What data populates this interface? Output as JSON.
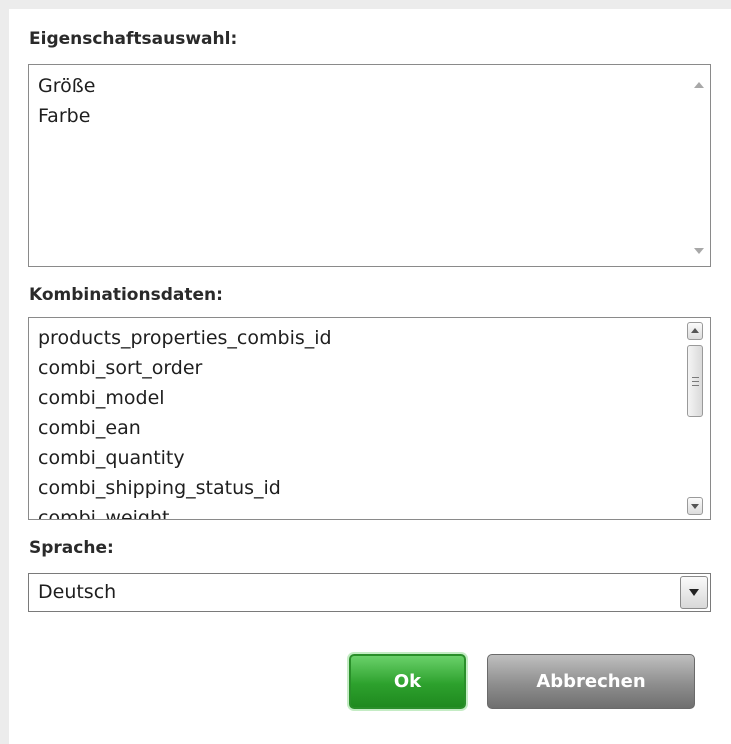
{
  "property_selection": {
    "label": "Eigenschaftsauswahl:",
    "items": [
      "Größe",
      "Farbe"
    ]
  },
  "combination_data": {
    "label": "Kombinationsdaten:",
    "items": [
      "products_properties_combis_id",
      "combi_sort_order",
      "combi_model",
      "combi_ean",
      "combi_quantity",
      "combi_shipping_status_id",
      "combi_weight"
    ]
  },
  "language": {
    "label": "Sprache:",
    "selected": "Deutsch"
  },
  "buttons": {
    "ok": "Ok",
    "cancel": "Abbrechen"
  }
}
